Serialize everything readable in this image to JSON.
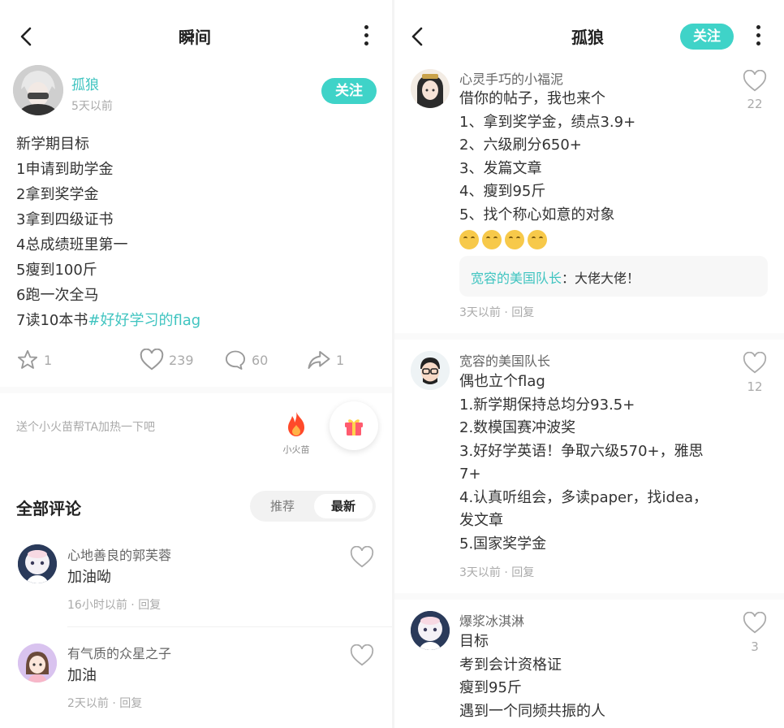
{
  "left": {
    "nav_title": "瞬间",
    "author": {
      "name": "孤狼",
      "time": "5天以前",
      "follow": "关注"
    },
    "post": {
      "lines": [
        "新学期目标",
        "1申请到助学金",
        "2拿到奖学金",
        "3拿到四级证书",
        "4总成绩班里第一",
        "5瘦到100斤",
        "6跑一次全马"
      ],
      "last_line_text": "7读10本书",
      "hashtag": "#好好学习的flag"
    },
    "actions": {
      "star": "1",
      "like": "239",
      "comment": "60",
      "share": "1"
    },
    "fire_hint": "送个小火苗帮TA加热一下吧",
    "fire_label": "小火苗",
    "comments_title": "全部评论",
    "sort": {
      "recommended": "推荐",
      "latest": "最新"
    },
    "comments": [
      {
        "name": "心地善良的郭芙蓉",
        "text": "加油呦",
        "time": "16小时以前",
        "reply": "回复"
      },
      {
        "name": "有气质的众星之子",
        "text": "加油",
        "time": "2天以前",
        "reply": "回复"
      }
    ]
  },
  "right": {
    "nav_title": "孤狼",
    "follow": "关注",
    "comments": [
      {
        "name": "心灵手巧的小福泥",
        "lines": [
          "借你的帖子，我也来个",
          "1、拿到奖学金，绩点3.9+",
          "2、六级刷分650+",
          "3、发篇文章",
          "4、瘦到95斤",
          "5、找个称心如意的对象"
        ],
        "likes": "22",
        "reply_who": "宽容的美国队长",
        "reply_text": "：大佬大佬！",
        "time": "3天以前",
        "reply": "回复"
      },
      {
        "name": "宽容的美国队长",
        "lines": [
          "偶也立个flag",
          "1.新学期保持总均分93.5+",
          "2.数模国赛冲波奖",
          "3.好好学英语！争取六级570+，雅思",
          "7+",
          "4.认真听组会，多读paper，找idea，",
          "发文章",
          "5.国家奖学金"
        ],
        "likes": "12",
        "time": "3天以前",
        "reply": "回复"
      },
      {
        "name": "爆浆冰淇淋",
        "lines": [
          "目标",
          "考到会计资格证",
          "瘦到95斤",
          "遇到一个同频共振的人"
        ],
        "likes": "3"
      }
    ]
  },
  "colors": {
    "accent": "#3fd3c8",
    "link": "#3fc4c0",
    "muted": "#aaaaaa"
  }
}
